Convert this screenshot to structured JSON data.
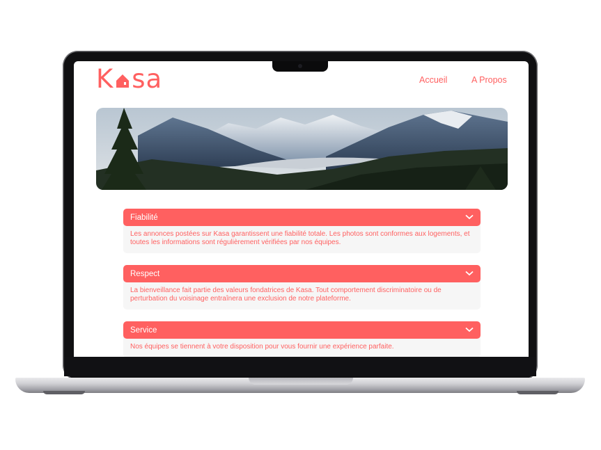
{
  "site": {
    "logo_text_left": "K",
    "logo_text_right": "sa",
    "brand_color": "#ff6060"
  },
  "nav": {
    "home_label": "Accueil",
    "about_label": "A Propos"
  },
  "banner": {
    "image": "mountain-landscape"
  },
  "accordions": [
    {
      "title": "Fiabilité",
      "content": "Les annonces postées sur Kasa garantissent une fiabilité totale. Les photos sont conformes aux logements, et toutes les informations sont régulièrement vérifiées par nos équipes.",
      "icon": "chevron-down-icon"
    },
    {
      "title": "Respect",
      "content": "La bienveillance fait partie des valeurs fondatrices de Kasa. Tout comportement discriminatoire ou de perturbation du voisinage entraînera une exclusion de notre plateforme.",
      "icon": "chevron-down-icon"
    },
    {
      "title": "Service",
      "content": "Nos équipes se tiennent à votre disposition pour vous fournir une expérience parfaite.",
      "icon": "chevron-down-icon"
    }
  ]
}
